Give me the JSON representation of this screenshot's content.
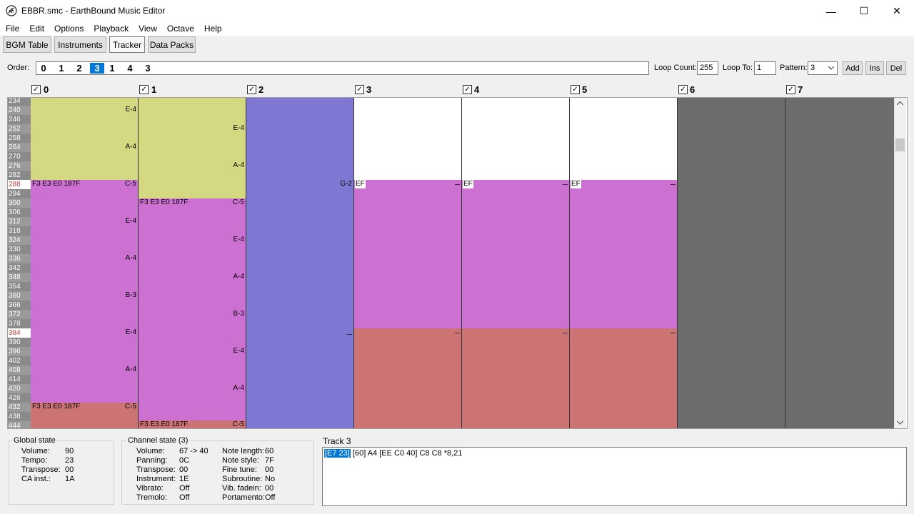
{
  "window": {
    "title": "EBBR.smc - EarthBound Music Editor",
    "minimize_glyph": "—",
    "maximize_glyph": "☐",
    "close_glyph": "✕"
  },
  "menu": [
    "File",
    "Edit",
    "Options",
    "Playback",
    "View",
    "Octave",
    "Help"
  ],
  "tabs": [
    {
      "label": "BGM Table"
    },
    {
      "label": "Instruments"
    },
    {
      "label": "Tracker"
    },
    {
      "label": "Data Packs"
    }
  ],
  "order": {
    "label": "Order:",
    "items": [
      "0",
      "1",
      "2",
      "3",
      "1",
      "4",
      "3"
    ],
    "selected_index": 3,
    "loop_count_label": "Loop Count:",
    "loop_count": "255",
    "loop_to_label": "Loop To:",
    "loop_to": "1",
    "pattern_label": "Pattern:",
    "pattern": "3",
    "add": "Add",
    "ins": "Ins",
    "del": "Del"
  },
  "channels": [
    "0",
    "1",
    "2",
    "3",
    "4",
    "5",
    "6",
    "7"
  ],
  "rows": [
    "234",
    "240",
    "246",
    "252",
    "258",
    "264",
    "270",
    "276",
    "282",
    "288",
    "294",
    "300",
    "306",
    "312",
    "318",
    "324",
    "330",
    "336",
    "342",
    "348",
    "354",
    "360",
    "366",
    "372",
    "378",
    "384",
    "390",
    "396",
    "402",
    "408",
    "414",
    "420",
    "426",
    "432",
    "438",
    "444"
  ],
  "colors": {
    "yellow": "#d4d880",
    "magenta": "#cc70d2",
    "salmon": "#cc7474",
    "blue": "#7f78d2",
    "gray": "#6c6c6c",
    "selection": "#0078d7"
  },
  "events": {
    "ch0": {
      "n1": "E-4",
      "n2": "A-4",
      "n3": "C-5",
      "n4": "E-4",
      "n5": "A-4",
      "n6": "B-3",
      "n7": "E-4",
      "n8": "A-4",
      "n9": "C-5",
      "cmd1": "F3 E3 E0 187F",
      "cmd2": "F3 E3 E0 187F"
    },
    "ch1": {
      "n1": "E-4",
      "n2": "A-4",
      "n3": "C-5",
      "n4": "E-4",
      "n5": "A-4",
      "n6": "B-3",
      "n7": "E-4",
      "n8": "A-4",
      "n9": "C-5",
      "cmd1": "F3 E3 E0 187F",
      "cmd2": "F3 E3 E0 187F"
    },
    "ch2": {
      "n1": "G-2"
    },
    "ch3": {
      "ef": "EF"
    },
    "ch4": {
      "ef": "EF"
    },
    "ch5": {
      "ef": "EF"
    }
  },
  "global_state": {
    "title": "Global state",
    "items": [
      {
        "k": "Volume:",
        "v": "90"
      },
      {
        "k": "Tempo:",
        "v": "23"
      },
      {
        "k": "Transpose:",
        "v": "00"
      },
      {
        "k": "CA inst.:",
        "v": "1A"
      }
    ]
  },
  "channel_state": {
    "title": "Channel state (3)",
    "left": [
      {
        "k": "Volume:",
        "v": "67 -> 40"
      },
      {
        "k": "Panning:",
        "v": "0C"
      },
      {
        "k": "Transpose:",
        "v": "00"
      },
      {
        "k": "Instrument:",
        "v": "1E"
      },
      {
        "k": "Vibrato:",
        "v": "Off"
      },
      {
        "k": "Tremolo:",
        "v": "Off"
      }
    ],
    "right": [
      {
        "k": "Note length:",
        "v": "60"
      },
      {
        "k": "Note style:",
        "v": "7F"
      },
      {
        "k": "Fine tune:",
        "v": "00"
      },
      {
        "k": "Subroutine:",
        "v": "No"
      },
      {
        "k": "Vib. fadein:",
        "v": "00"
      },
      {
        "k": "Portamento:",
        "v": "Off"
      }
    ]
  },
  "track": {
    "title": "Track 3",
    "highlight": "[E7 23]",
    "rest": " [60] A4 [EE C0 40] C8 C8 *8,21"
  }
}
